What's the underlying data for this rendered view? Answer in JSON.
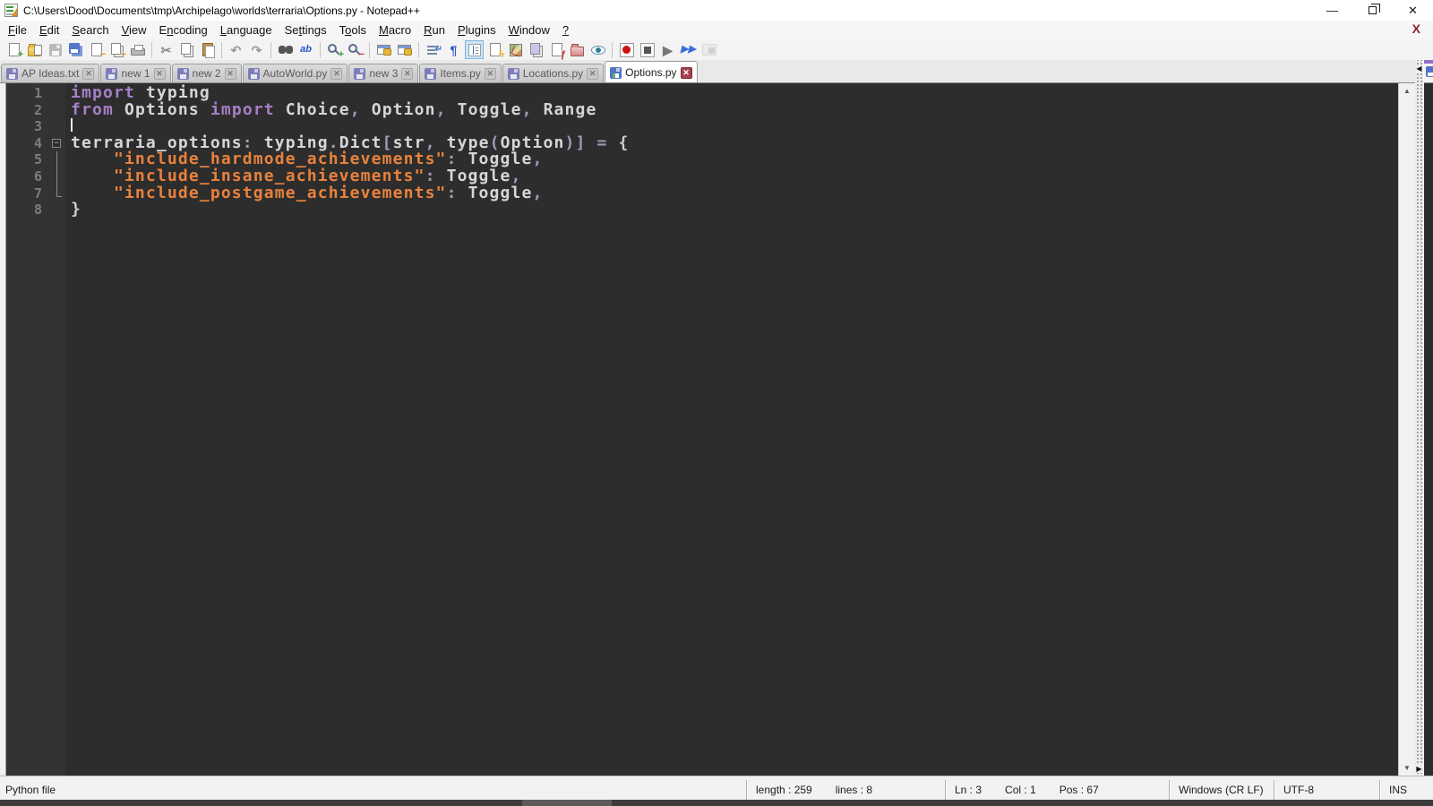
{
  "window": {
    "title": "C:\\Users\\Dood\\Documents\\tmp\\Archipelago\\worlds\\terraria\\Options.py - Notepad++",
    "controls": {
      "minimize": "—",
      "restore": "restore",
      "close": "✕"
    }
  },
  "menu": {
    "items": [
      {
        "label": "File",
        "mnemonic": 0
      },
      {
        "label": "Edit",
        "mnemonic": 0
      },
      {
        "label": "Search",
        "mnemonic": 0
      },
      {
        "label": "View",
        "mnemonic": 0
      },
      {
        "label": "Encoding",
        "mnemonic": 1
      },
      {
        "label": "Language",
        "mnemonic": 0
      },
      {
        "label": "Settings",
        "mnemonic": 2
      },
      {
        "label": "Tools",
        "mnemonic": 1
      },
      {
        "label": "Macro",
        "mnemonic": 0
      },
      {
        "label": "Run",
        "mnemonic": 0
      },
      {
        "label": "Plugins",
        "mnemonic": 0
      },
      {
        "label": "Window",
        "mnemonic": 0
      },
      {
        "label": "?",
        "mnemonic": 0
      }
    ],
    "close_doc_x": "X"
  },
  "toolbar": {
    "items": [
      {
        "name": "new-file-icon",
        "base": "page",
        "badge": "+",
        "badgeColor": "#3a9b35"
      },
      {
        "name": "open-file-icon",
        "base": "folder-page"
      },
      {
        "name": "save-file-icon",
        "base": "disk",
        "disabled": true
      },
      {
        "name": "save-all-icon",
        "base": "disks"
      },
      {
        "name": "close-file-icon",
        "base": "page",
        "badge": "−",
        "badgeColor": "#e08a00"
      },
      {
        "name": "close-all-files-icon",
        "base": "pages",
        "badge": "−",
        "badgeColor": "#e08a00"
      },
      {
        "name": "print-icon",
        "base": "printer"
      },
      {
        "name": "cut-icon",
        "glyph": "✂",
        "color": "#8a8a8a",
        "sep": true
      },
      {
        "name": "copy-icon",
        "base": "pages"
      },
      {
        "name": "paste-icon",
        "base": "clipboard"
      },
      {
        "name": "undo-icon",
        "glyph": "↶",
        "color": "#9a9a9a",
        "sep": true
      },
      {
        "name": "redo-icon",
        "glyph": "↷",
        "color": "#9a9a9a"
      },
      {
        "name": "find-icon",
        "base": "binoculars",
        "sep": true
      },
      {
        "name": "replace-icon",
        "glyph": "ab",
        "color": "#2255cc",
        "small": true
      },
      {
        "name": "zoom-in-icon",
        "base": "magnifier",
        "badge": "+",
        "badgeColor": "#3a9b35",
        "sep": true
      },
      {
        "name": "zoom-out-icon",
        "base": "magnifier",
        "badge": "−",
        "badgeColor": "#cc3333"
      },
      {
        "name": "sync-vertical-scrolling-icon",
        "base": "window-lock",
        "sep": true
      },
      {
        "name": "sync-horizontal-scrolling-icon",
        "base": "window-lock"
      },
      {
        "name": "word-wrap-icon",
        "base": "wrap",
        "sep": true
      },
      {
        "name": "show-all-characters-icon",
        "glyph": "¶",
        "color": "#2a57c8"
      },
      {
        "name": "show-indent-guide-icon",
        "base": "indent",
        "active": true
      },
      {
        "name": "user-defined-language-icon",
        "base": "page",
        "badge": "ϟ",
        "badgeColor": "#e0a800"
      },
      {
        "name": "document-map-icon",
        "base": "map"
      },
      {
        "name": "document-switcher-icon",
        "base": "pages-purple"
      },
      {
        "name": "function-list-icon",
        "base": "page",
        "badge": "ƒ",
        "badgeColor": "#c03030"
      },
      {
        "name": "folder-as-workspace-icon",
        "base": "folder-pink"
      },
      {
        "name": "monitoring-icon",
        "base": "eye"
      },
      {
        "name": "macro-record-icon",
        "base": "record",
        "sep": true
      },
      {
        "name": "macro-stop-icon",
        "base": "stop"
      },
      {
        "name": "macro-playback-icon",
        "glyph": "▶",
        "color": "#777777"
      },
      {
        "name": "macro-run-multiple-icon",
        "glyph": "▶▶",
        "color": "#3a6fd8",
        "small": true
      },
      {
        "name": "macro-save-icon",
        "base": "macro-save",
        "disabled": true
      }
    ]
  },
  "tabs": [
    {
      "label": "AP Ideas.txt",
      "active": false
    },
    {
      "label": "new 1",
      "active": false
    },
    {
      "label": "new 2",
      "active": false
    },
    {
      "label": "AutoWorld.py",
      "active": false
    },
    {
      "label": "new 3",
      "active": false
    },
    {
      "label": "Items.py",
      "active": false
    },
    {
      "label": "Locations.py",
      "active": false
    },
    {
      "label": "Options.py",
      "active": true
    }
  ],
  "editor": {
    "caret_line": 3,
    "lines": [
      {
        "num": "1",
        "fold": "",
        "tokens": [
          [
            "kw",
            "import"
          ],
          [
            "pl",
            " "
          ],
          [
            "id",
            "typing"
          ]
        ]
      },
      {
        "num": "2",
        "fold": "",
        "tokens": [
          [
            "kw",
            "from"
          ],
          [
            "pl",
            " "
          ],
          [
            "id",
            "Options"
          ],
          [
            "pl",
            " "
          ],
          [
            "kw",
            "import"
          ],
          [
            "pl",
            " "
          ],
          [
            "id",
            "Choice"
          ],
          [
            "op",
            ","
          ],
          [
            "pl",
            " "
          ],
          [
            "id",
            "Option"
          ],
          [
            "op",
            ","
          ],
          [
            "pl",
            " "
          ],
          [
            "id",
            "Toggle"
          ],
          [
            "op",
            ","
          ],
          [
            "pl",
            " "
          ],
          [
            "id",
            "Range"
          ]
        ]
      },
      {
        "num": "3",
        "fold": "",
        "tokens": []
      },
      {
        "num": "4",
        "fold": "box",
        "tokens": [
          [
            "id",
            "terraria_options"
          ],
          [
            "op",
            ":"
          ],
          [
            "pl",
            " "
          ],
          [
            "id",
            "typing"
          ],
          [
            "op",
            "."
          ],
          [
            "id",
            "Dict"
          ],
          [
            "op",
            "["
          ],
          [
            "id",
            "str"
          ],
          [
            "op",
            ","
          ],
          [
            "pl",
            " "
          ],
          [
            "id",
            "type"
          ],
          [
            "op",
            "("
          ],
          [
            "id",
            "Option"
          ],
          [
            "op",
            ")"
          ],
          [
            "op",
            "]"
          ],
          [
            "pl",
            " "
          ],
          [
            "op",
            "="
          ],
          [
            "pl",
            " "
          ],
          [
            "br",
            "{"
          ]
        ]
      },
      {
        "num": "5",
        "fold": "line",
        "tokens": [
          [
            "pl",
            "    "
          ],
          [
            "str",
            "\"include_hardmode_achievements\""
          ],
          [
            "op",
            ":"
          ],
          [
            "pl",
            " "
          ],
          [
            "id",
            "Toggle"
          ],
          [
            "op",
            ","
          ]
        ]
      },
      {
        "num": "6",
        "fold": "line",
        "tokens": [
          [
            "pl",
            "    "
          ],
          [
            "str",
            "\"include_insane_achievements\""
          ],
          [
            "op",
            ":"
          ],
          [
            "pl",
            " "
          ],
          [
            "id",
            "Toggle"
          ],
          [
            "op",
            ","
          ]
        ]
      },
      {
        "num": "7",
        "fold": "corner",
        "tokens": [
          [
            "pl",
            "    "
          ],
          [
            "str",
            "\"include_postgame_achievements\""
          ],
          [
            "op",
            ":"
          ],
          [
            "pl",
            " "
          ],
          [
            "id",
            "Toggle"
          ],
          [
            "op",
            ","
          ]
        ]
      },
      {
        "num": "8",
        "fold": "",
        "tokens": [
          [
            "br",
            "}"
          ]
        ]
      }
    ]
  },
  "scrollbar": {
    "up": "▲",
    "down": "▼"
  },
  "splitter": {
    "top_arrow": "◀",
    "bottom_arrow": "▶"
  },
  "status": {
    "doc_type": "Python file",
    "length_info": "length : 259",
    "lines_info": "lines : 8",
    "ln": "Ln : 3",
    "col": "Col : 1",
    "pos": "Pos : 67",
    "eol": "Windows (CR LF)",
    "encoding": "UTF-8",
    "mode": "INS"
  },
  "colors": {
    "keyword": "#a77fc7",
    "identifier": "#d6d6d6",
    "operator": "#a898b8",
    "string": "#e8823d",
    "editor_bg": "#2d2d2d",
    "gutter_bg": "#333333",
    "active_tab_close": "#a64250"
  }
}
